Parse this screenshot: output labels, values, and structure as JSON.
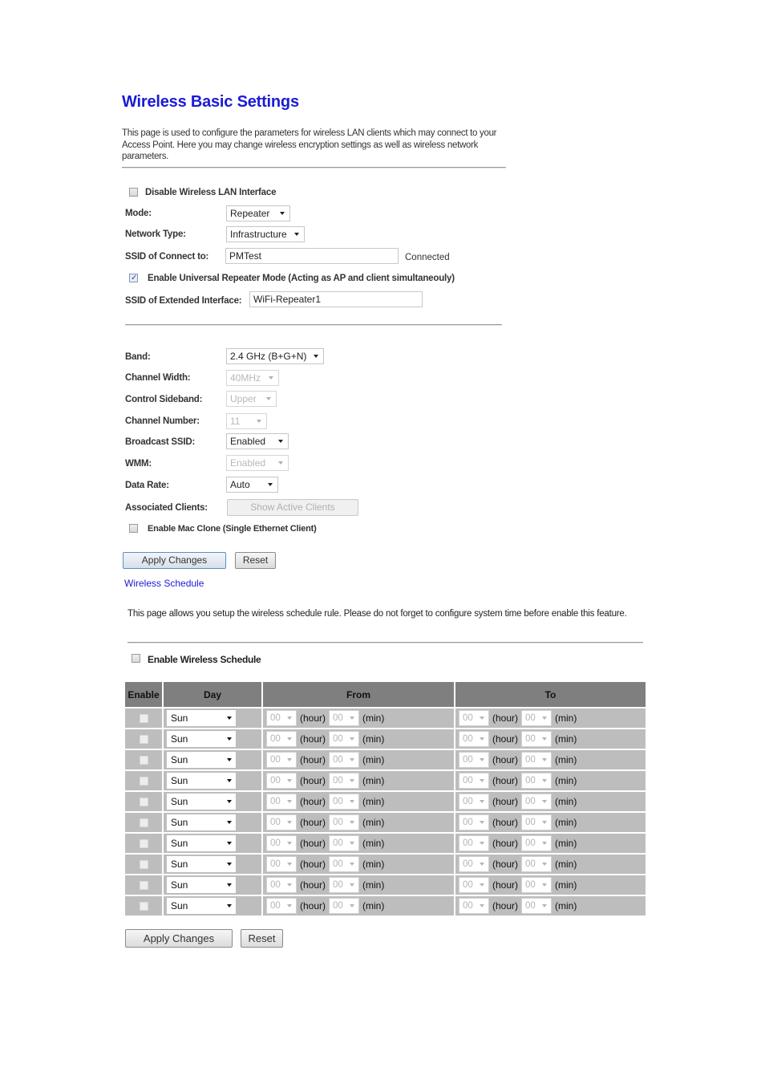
{
  "page": {
    "title": "Wireless Basic Settings",
    "intro": "This page is used to configure the parameters for wireless LAN clients which may connect to your Access Point. Here you may change wireless encryption settings as well as wireless network parameters."
  },
  "basic": {
    "disable_wlan_label": "Disable Wireless LAN Interface",
    "disable_wlan_checked": false,
    "mode_label": "Mode:",
    "mode_value": "Repeater",
    "network_type_label": "Network Type:",
    "network_type_value": "Infrastructure",
    "ssid_connect_label": "SSID of Connect to:",
    "ssid_connect_value": "PMTest",
    "connection_status": "Connected",
    "universal_repeater_label": "Enable Universal Repeater Mode (Acting as AP and client simultaneouly)",
    "universal_repeater_checked": true,
    "ssid_extended_label": "SSID of Extended Interface:",
    "ssid_extended_value": "WiFi-Repeater1"
  },
  "radio": {
    "band_label": "Band:",
    "band_value": "2.4 GHz (B+G+N)",
    "channel_width_label": "Channel Width:",
    "channel_width_value": "40MHz",
    "control_sideband_label": "Control Sideband:",
    "control_sideband_value": "Upper",
    "channel_number_label": "Channel Number:",
    "channel_number_value": "11",
    "broadcast_ssid_label": "Broadcast SSID:",
    "broadcast_ssid_value": "Enabled",
    "wmm_label": "WMM:",
    "wmm_value": "Enabled",
    "data_rate_label": "Data Rate:",
    "data_rate_value": "Auto",
    "associated_clients_label": "Associated Clients:",
    "show_clients_button": "Show Active Clients",
    "mac_clone_label": "Enable Mac Clone (Single Ethernet Client)",
    "mac_clone_checked": false,
    "apply_button": "Apply Changes",
    "reset_button": "Reset"
  },
  "schedule": {
    "link": "Wireless Schedule",
    "intro": "This page allows you setup the wireless schedule rule. Please do not forget to configure system time before enable this feature.",
    "enable_label": "Enable Wireless Schedule",
    "enable_checked": false,
    "headers": {
      "enable": "Enable",
      "day": "Day",
      "from": "From",
      "to": "To"
    },
    "hour_unit": "(hour)",
    "min_unit": "(min)",
    "rows": [
      {
        "enabled": false,
        "day": "Sun",
        "from_hour": "00",
        "from_min": "00",
        "to_hour": "00",
        "to_min": "00"
      },
      {
        "enabled": false,
        "day": "Sun",
        "from_hour": "00",
        "from_min": "00",
        "to_hour": "00",
        "to_min": "00"
      },
      {
        "enabled": false,
        "day": "Sun",
        "from_hour": "00",
        "from_min": "00",
        "to_hour": "00",
        "to_min": "00"
      },
      {
        "enabled": false,
        "day": "Sun",
        "from_hour": "00",
        "from_min": "00",
        "to_hour": "00",
        "to_min": "00"
      },
      {
        "enabled": false,
        "day": "Sun",
        "from_hour": "00",
        "from_min": "00",
        "to_hour": "00",
        "to_min": "00"
      },
      {
        "enabled": false,
        "day": "Sun",
        "from_hour": "00",
        "from_min": "00",
        "to_hour": "00",
        "to_min": "00"
      },
      {
        "enabled": false,
        "day": "Sun",
        "from_hour": "00",
        "from_min": "00",
        "to_hour": "00",
        "to_min": "00"
      },
      {
        "enabled": false,
        "day": "Sun",
        "from_hour": "00",
        "from_min": "00",
        "to_hour": "00",
        "to_min": "00"
      },
      {
        "enabled": false,
        "day": "Sun",
        "from_hour": "00",
        "from_min": "00",
        "to_hour": "00",
        "to_min": "00"
      },
      {
        "enabled": false,
        "day": "Sun",
        "from_hour": "00",
        "from_min": "00",
        "to_hour": "00",
        "to_min": "00"
      }
    ],
    "apply_button": "Apply Changes",
    "reset_button": "Reset"
  },
  "colors": {
    "title": "#1a1ad6",
    "link": "#1a1ad6",
    "table_header": "#7f7f7f",
    "table_row": "#bdbdbd"
  }
}
